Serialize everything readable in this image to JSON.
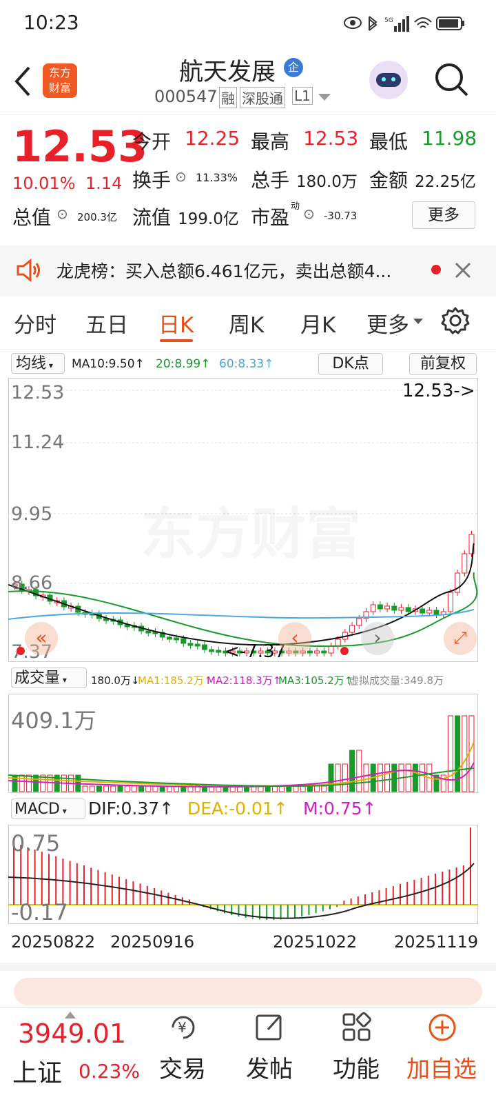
{
  "status": {
    "time": "10:23",
    "signal": "5G"
  },
  "header": {
    "stock_name": "航天发展",
    "badge": "企",
    "code": "000547",
    "tags": [
      "融",
      "深股通",
      "L1"
    ],
    "logo_line1": "东方",
    "logo_line2": "财富"
  },
  "quote": {
    "price": "12.53",
    "change_pct": "10.01%",
    "change": "1.14",
    "open_label": "今开",
    "open": "12.25",
    "high_label": "最高",
    "high": "12.53",
    "low_label": "最低",
    "low": "11.98",
    "turnover_label": "换手",
    "turnover": "11.33%",
    "volume_label": "总手",
    "volume": "180.0万",
    "amount_label": "金额",
    "amount": "22.25亿",
    "mktcap_label": "总值",
    "mktcap": "200.3亿",
    "float_label": "流值",
    "float": "199.0亿",
    "pe_label": "市盈",
    "pe_sup": "动",
    "pe": "-30.73",
    "more": "更多"
  },
  "notice": {
    "text": "龙虎榜：买入总额6.461亿元，卖出总额4..."
  },
  "tabs": [
    "分时",
    "五日",
    "日K",
    "周K",
    "月K",
    "更多"
  ],
  "active_tab": "日K",
  "kline": {
    "ma_select": "均线",
    "ma10": "MA10:9.50↑",
    "ma20": "20:8.99↑",
    "ma60": "60:8.33↑",
    "dk": "DK点",
    "adjust": "前复权",
    "y_top": "12.53",
    "y_2": "11.24",
    "y_3": "9.95",
    "y_4": "8.66",
    "y_bottom": "7.37",
    "last_label": "12.53->",
    "low_label": "<-7.37",
    "watermark": "东方财富"
  },
  "volume": {
    "select": "成交量",
    "current": "180.0万↓",
    "ma1": "MA1:185.2万↑",
    "ma2": "MA2:118.3万↑",
    "ma3": "MA3:105.2万↑",
    "virtual": "虚拟成交量:349.8万",
    "y_top": "409.1万"
  },
  "macd": {
    "select": "MACD",
    "dif": "DIF:0.37↑",
    "dea": "DEA:-0.01↑",
    "m": "M:0.75↑",
    "y_top": "0.75",
    "y_bottom": "-0.17"
  },
  "dates": [
    "20250822",
    "20250916",
    "20251022",
    "20251119"
  ],
  "bottom_nav": {
    "index_value": "3949.01",
    "index_name": "上证",
    "index_pct": "0.23%",
    "trade": "交易",
    "post": "发帖",
    "func": "功能",
    "add": "加自选"
  },
  "colors": {
    "up": "#e8202a",
    "down": "#1a9a2a",
    "accent": "#e8501a"
  }
}
